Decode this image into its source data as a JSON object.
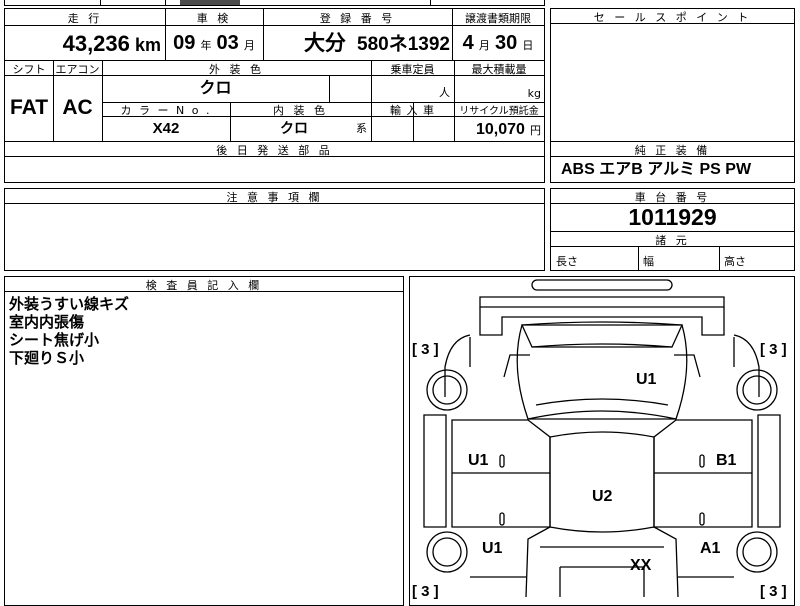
{
  "sheet": {
    "top_cut_text": "",
    "mileage": {
      "label": "走 行",
      "value": "43,236",
      "unit": "km"
    },
    "inspection": {
      "label": "車 検",
      "year": "09",
      "year_unit": "年",
      "month": "03",
      "month_unit": "月"
    },
    "registration": {
      "label": "登 録 番 号",
      "place": "大分",
      "number": "580ネ1392"
    },
    "transfer_deadline": {
      "label": "譲渡書類期限",
      "month": "4",
      "month_unit": "月",
      "day": "30",
      "day_unit": "日"
    },
    "shift": {
      "label": "シフト",
      "value": "FAT"
    },
    "aircon": {
      "label": "エアコン",
      "value": "AC"
    },
    "exterior_color": {
      "label": "外 装 色",
      "value": "クロ"
    },
    "capacity": {
      "label": "乗車定員",
      "unit": "人",
      "value": ""
    },
    "max_load": {
      "label": "最大積載量",
      "unit": "kg",
      "value": ""
    },
    "color_no": {
      "label": "カ ラ ー N o .",
      "value": "X42"
    },
    "interior_color": {
      "label": "内 装 色",
      "value": "クロ",
      "suffix": "系"
    },
    "import": {
      "label": "輸 入 車",
      "value": ""
    },
    "recycle": {
      "label": "リサイクル預託金",
      "value": "10,070",
      "unit": "円"
    },
    "later_parts": {
      "label": "後 日 発 送 部 品",
      "value": ""
    },
    "notes_field": {
      "label": "注 意 事 項 欄",
      "value": ""
    },
    "sales_point": {
      "label": "セ ー ル ス ポ イ ン ト",
      "value": ""
    },
    "equipment": {
      "label": "純 正 装 備",
      "value": "ABS エアB アルミ PS PW"
    },
    "chassis": {
      "label": "車 台 番 号",
      "value": "1011929"
    },
    "dimensions": {
      "label": "諸 元",
      "length": "長さ",
      "width": "幅",
      "height": "高さ"
    },
    "inspector": {
      "label": "検 査 員 記 入 欄",
      "lines": [
        "外装うすい線キズ",
        "室内内張傷",
        "シート焦げ小",
        "下廻りＳ小"
      ]
    }
  },
  "diagram": {
    "brackets": {
      "top_left": "[ 3 ]",
      "top_right": "[ 3 ]",
      "bottom_left": "[ 3 ]",
      "bottom_right": "[ 3 ]"
    },
    "marks": {
      "roof": "U1",
      "left_front": "U1",
      "right_front": "B1",
      "center": "U2",
      "left_rear": "U1",
      "right_rear": "A1",
      "tail": "XX"
    }
  }
}
